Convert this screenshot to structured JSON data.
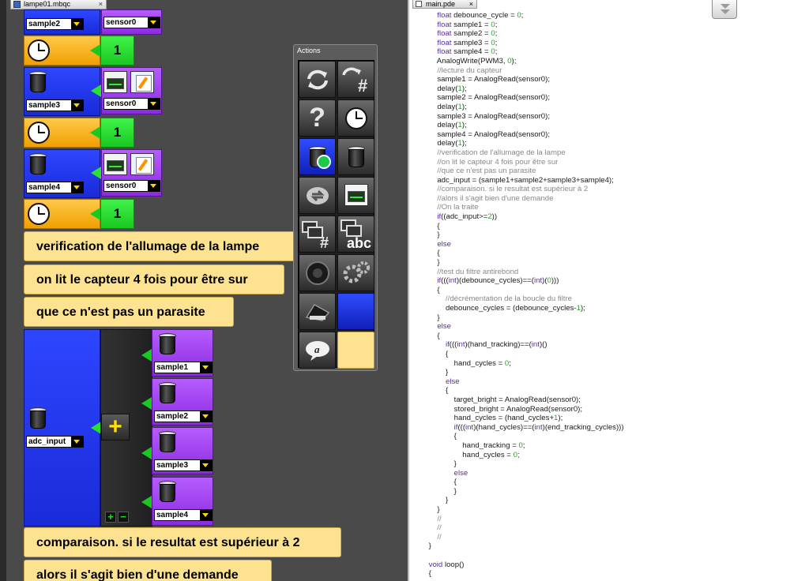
{
  "left_tab": {
    "label": "lampe01.mbqc"
  },
  "right_tab": {
    "label": "main.pde"
  },
  "palette": {
    "title": "Actions",
    "tiles": [
      "refresh-icon",
      "refresh-number-icon",
      "question-icon",
      "clock-icon",
      "bin-star-icon",
      "bin-icon",
      "shuffle-icon",
      "monitor-icon",
      "display-number-icon",
      "display-abc-icon",
      "speaker-icon",
      "gears-icon",
      "piano-icon",
      "empty",
      "speech-a-icon",
      "empty-yellow"
    ],
    "tile_text": {
      "number": "#",
      "abc": "abc",
      "question": "?",
      "speech": "a"
    }
  },
  "blocks": {
    "top": {
      "var": "sample2",
      "sensor": "sensor0"
    },
    "row1": {
      "num": "1"
    },
    "row2": {
      "var": "sample3",
      "sensor": "sensor0"
    },
    "row3": {
      "num": "1"
    },
    "row4": {
      "var": "sample4",
      "sensor": "sensor0"
    },
    "row5": {
      "num": "1"
    },
    "notes": [
      "verification de l'allumage de la lampe",
      "on lit le capteur 4 fois pour être sur",
      "que ce n'est pas un parasite"
    ],
    "sum": {
      "target": "adc_input",
      "plus": "+",
      "items": [
        "sample1",
        "sample2",
        "sample3",
        "sample4"
      ],
      "pm_plus": "+",
      "pm_minus": "−"
    },
    "notes2": [
      "comparaison. si le resultat est supérieur à 2",
      "alors il s'agit bien d'une demande"
    ]
  },
  "code_lines": [
    "        float debounce_cycle = 0;",
    "        float sample1 = 0;",
    "        float sample2 = 0;",
    "        float sample3 = 0;",
    "        float sample4 = 0;",
    "        AnalogWrite(PWM3, 0);",
    "        //lecture du capteur",
    "        sample1 = AnalogRead(sensor0);",
    "        delay(1);",
    "        sample2 = AnalogRead(sensor0);",
    "        delay(1);",
    "        sample3 = AnalogRead(sensor0);",
    "        delay(1);",
    "        sample4 = AnalogRead(sensor0);",
    "        delay(1);",
    "        //verification de l'allumage de la lampe",
    "        //on lit le capteur 4 fois pour être sur",
    "        //que ce n'est pas un parasite",
    "        adc_input = (sample1+sample2+sample3+sample4);",
    "        //comparaison. si le resultat est supérieur à 2",
    "        //alors il s'agit bien d'une demande",
    "        //On la traite",
    "        if((adc_input>=2))",
    "        {",
    "        }",
    "        else",
    "        {",
    "        }",
    "        //test du filtre antirebond",
    "        if(((int)(debounce_cycles)==(int)(0)))",
    "        {",
    "            //décrémentation de la boucle du filtre",
    "            debounce_cycles = (debounce_cycles-1);",
    "        }",
    "        else",
    "        {",
    "            if(((int)(hand_tracking)==(int)()",
    "            {",
    "                hand_cycles = 0;",
    "            }",
    "            else",
    "            {",
    "                target_bright = AnalogRead(sensor0);",
    "                stored_bright = AnalogRead(sensor0);",
    "                hand_cycles = (hand_cycles+1);",
    "                if(((int)(hand_cycles)==(int)(end_tracking_cycles)))",
    "                {",
    "                    hand_tracking = 0;",
    "                    hand_cycles = 0;",
    "                }",
    "                else",
    "                {",
    "                }",
    "            }",
    "        }",
    "        //",
    "        //",
    "        //",
    "    }",
    "",
    "    void loop()",
    "    {"
  ]
}
